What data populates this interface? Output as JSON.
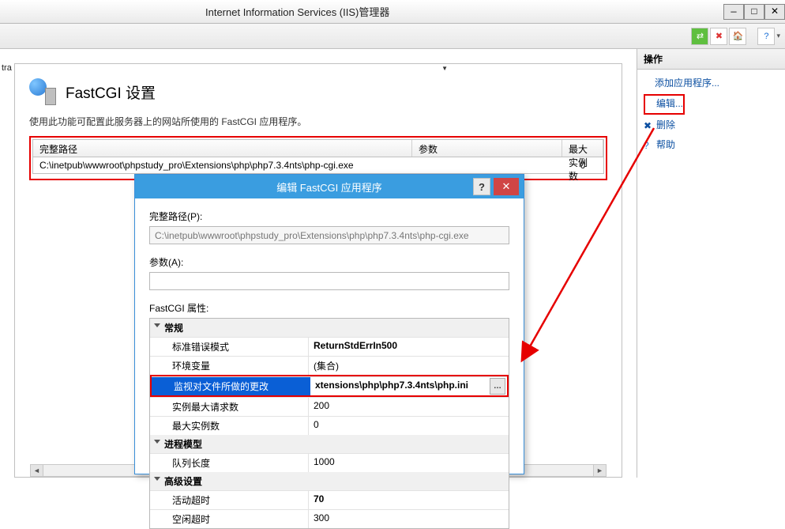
{
  "window": {
    "title": "Internet Information Services (IIS)管理器"
  },
  "page": {
    "heading": "FastCGI 设置",
    "description": "使用此功能可配置此服务器上的网站所使用的 FastCGI 应用程序。"
  },
  "leftTabFragment": "tra",
  "grid": {
    "headers": {
      "path": "完整路径",
      "param": "参数",
      "max": "最大实例数"
    },
    "row": {
      "path": "C:\\inetpub\\wwwroot\\phpstudy_pro\\Extensions\\php\\php7.3.4nts\\php-cgi.exe",
      "param": "",
      "max": "0"
    }
  },
  "actions": {
    "title": "操作",
    "add": "添加应用程序...",
    "edit": "编辑...",
    "delete": "删除",
    "help": "帮助"
  },
  "dialog": {
    "title": "编辑 FastCGI 应用程序",
    "fullPathLabel": "完整路径(P):",
    "fullPathValue": "C:\\inetpub\\wwwroot\\phpstudy_pro\\Extensions\\php\\php7.3.4nts\\php-cgi.exe",
    "paramsLabel": "参数(A):",
    "paramsValue": "",
    "propsLabel": "FastCGI 属性:",
    "categories": {
      "general": "常规",
      "process": "进程模型",
      "advanced": "高级设置"
    },
    "props": {
      "stdErrMode": {
        "name": "标准错误模式",
        "value": "ReturnStdErrIn500"
      },
      "envVars": {
        "name": "环境变量",
        "value": "(集合)"
      },
      "monitorChanges": {
        "name": "监视对文件所做的更改",
        "value": "xtensions\\php\\php7.3.4nts\\php.ini"
      },
      "maxRequests": {
        "name": "实例最大请求数",
        "value": "200"
      },
      "maxInstances": {
        "name": "最大实例数",
        "value": "0"
      },
      "queueLength": {
        "name": "队列长度",
        "value": "1000"
      },
      "activityTimeout": {
        "name": "活动超时",
        "value": "70"
      },
      "idleTimeout": {
        "name": "空闲超时",
        "value": "300"
      }
    }
  }
}
